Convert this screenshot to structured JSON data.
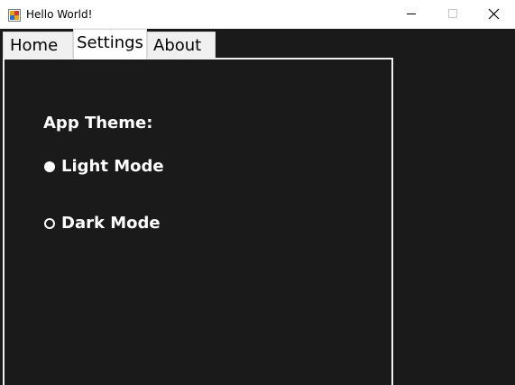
{
  "window": {
    "title": "Hello World!",
    "icon": "winforms-app-icon"
  },
  "caption_buttons": {
    "minimize": "minimize-icon",
    "maximize": "maximize-icon",
    "close": "close-icon"
  },
  "tabs": [
    {
      "label": "Home",
      "selected": false
    },
    {
      "label": "Settings",
      "selected": true
    },
    {
      "label": "About",
      "selected": false
    }
  ],
  "settings": {
    "theme_label": "App Theme:",
    "options": [
      {
        "label": "Light Mode",
        "checked": true
      },
      {
        "label": "Dark Mode",
        "checked": false
      }
    ]
  },
  "colors": {
    "background": "#1a1a1a",
    "text": "#ffffff",
    "titlebar": "#ffffff"
  }
}
